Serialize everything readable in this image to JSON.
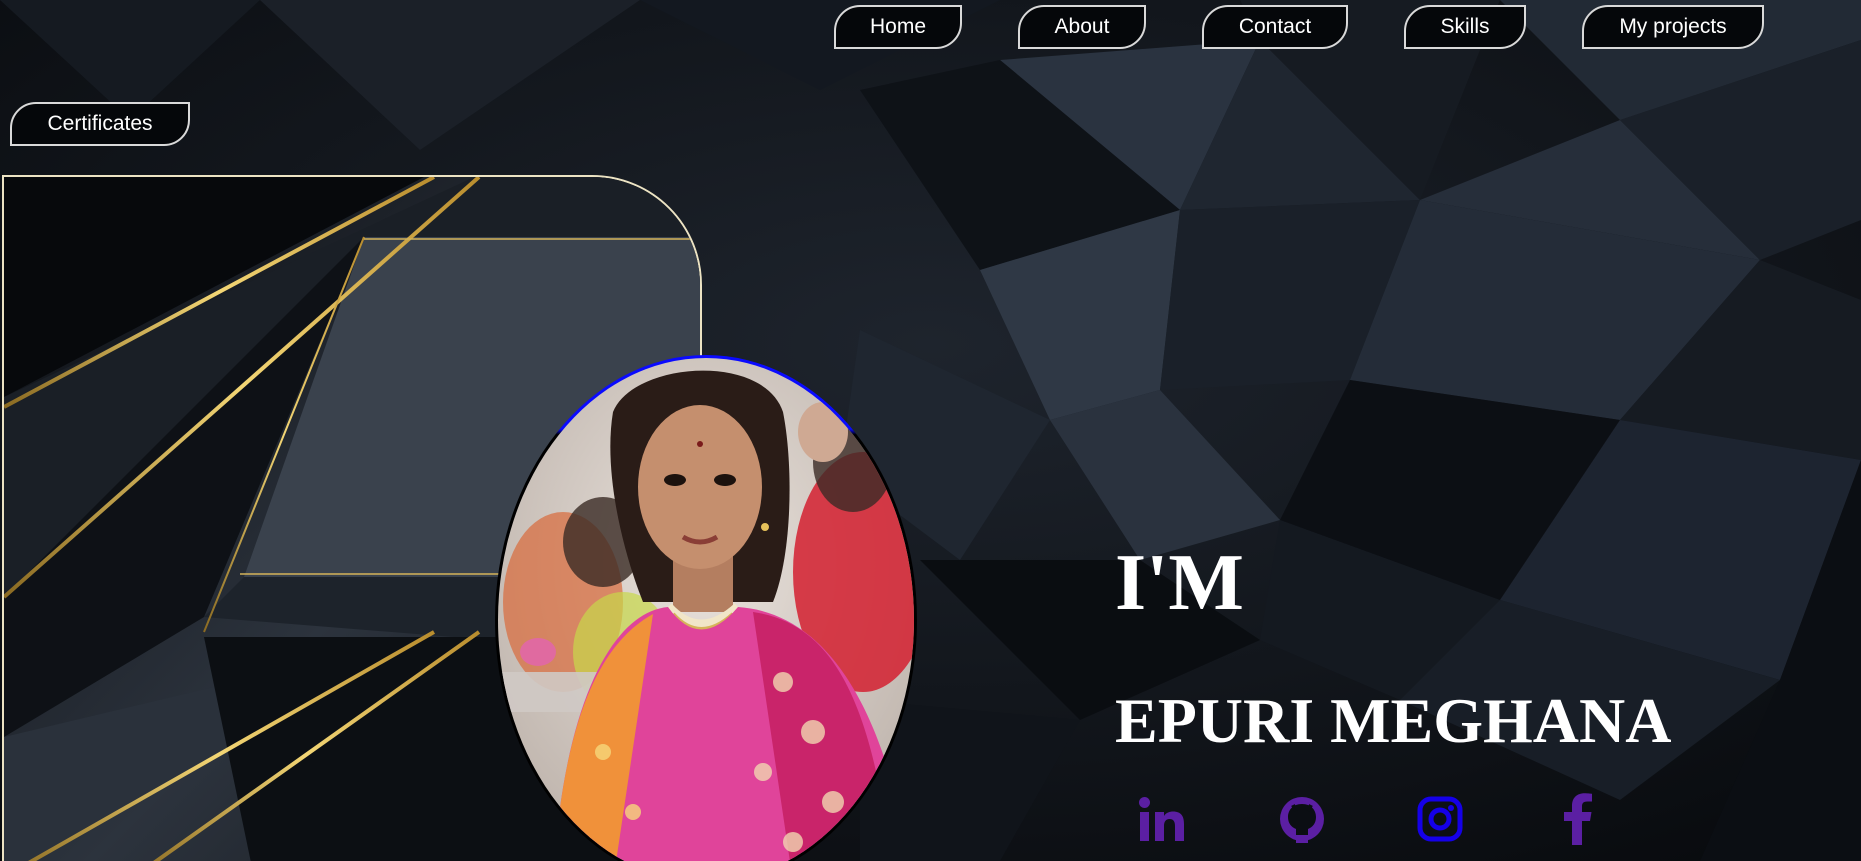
{
  "nav": {
    "home": "Home",
    "about": "About",
    "contact": "Contact",
    "skills": "Skills",
    "projects": "My projects",
    "certificates": "Certificates"
  },
  "hero": {
    "greeting": "I'M",
    "name": "EPURI MEGHANA"
  },
  "social": [
    {
      "icon": "linkedin-icon",
      "color": "#5b1fa3"
    },
    {
      "icon": "github-icon",
      "color": "#5b1fa3"
    },
    {
      "icon": "instagram-icon",
      "color": "#1500e8"
    },
    {
      "icon": "facebook-icon",
      "color": "#5b1fa3"
    }
  ],
  "colors": {
    "background": "#0b0e13",
    "gold_accent": "#d9b24a",
    "avatar_ring": "#0a0aff",
    "nav_border": "#d9d9d9"
  }
}
